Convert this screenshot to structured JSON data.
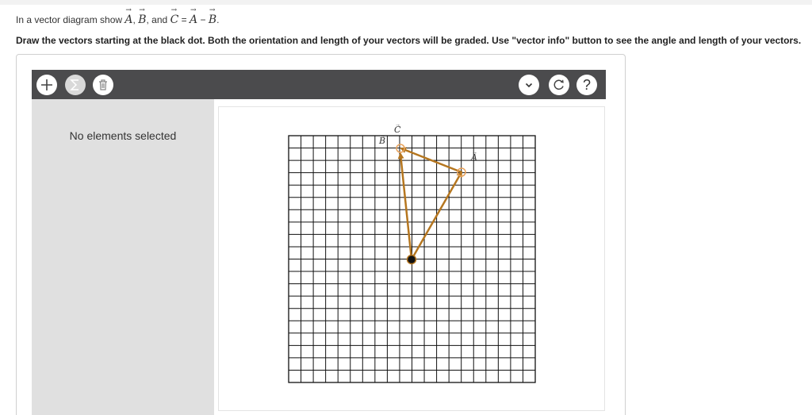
{
  "question": {
    "prefix": "In a vector diagram show",
    "vec_a": "A",
    "comma1": ",",
    "vec_b": "B",
    "and": ", and",
    "vec_c": "C",
    "eq": "=",
    "vec_a2": "A",
    "minus": "−",
    "vec_b2": "B",
    "period": "."
  },
  "instructions": "Draw the vectors starting at the black dot. Both the orientation and length of your vectors will be graded. Use \"vector info\" button to see the angle and length of your vectors.",
  "toolbar": {
    "add_icon": "plus-icon",
    "sum_icon": "sigma-icon",
    "delete_icon": "trash-icon",
    "dropdown_icon": "chevron-down-icon",
    "reset_icon": "reset-icon",
    "help_label": "?"
  },
  "sidebar": {
    "message": "No elements selected"
  },
  "diagram": {
    "grid_columns": 20,
    "grid_rows": 20,
    "vector_color": "#b5761f",
    "labels": {
      "a": "A",
      "b": "B",
      "c": "C"
    }
  }
}
